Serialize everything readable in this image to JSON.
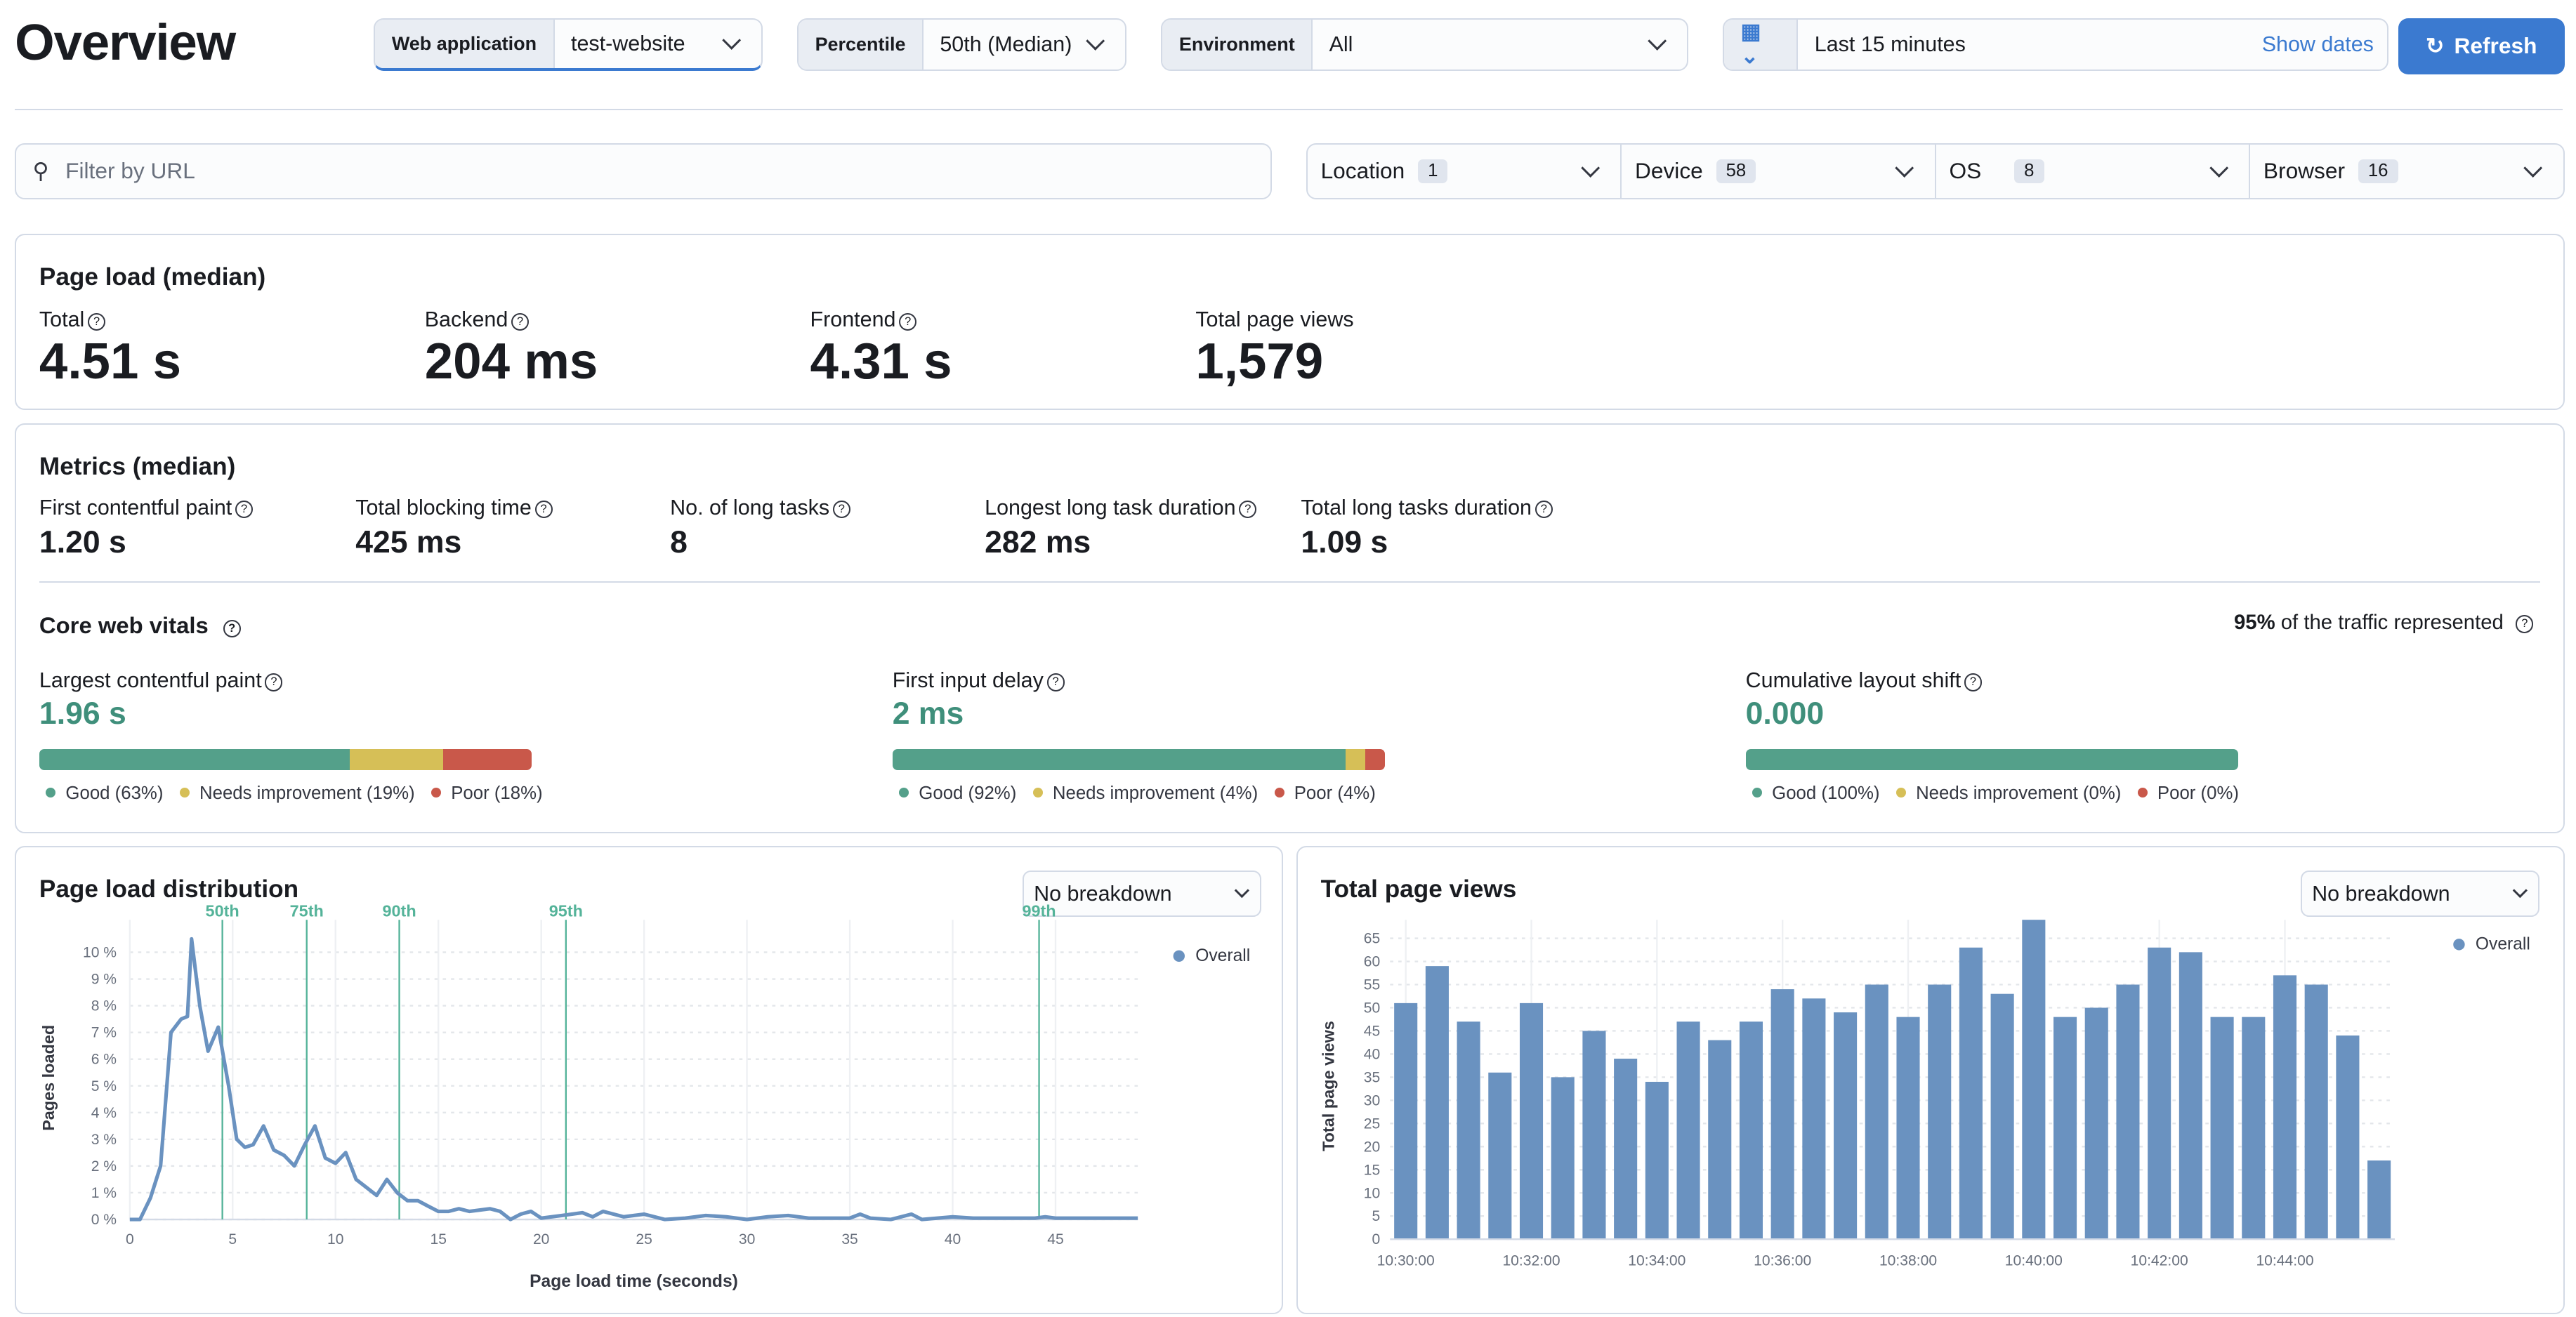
{
  "header": {
    "title": "Overview",
    "web_app": {
      "label": "Web application",
      "value": "test-website"
    },
    "percentile": {
      "label": "Percentile",
      "value": "50th (Median)"
    },
    "environment": {
      "label": "Environment",
      "value": "All"
    },
    "time": {
      "value": "Last 15 minutes",
      "show_dates": "Show dates"
    },
    "refresh": "Refresh"
  },
  "filters": {
    "search_placeholder": "Filter by URL",
    "items": [
      {
        "label": "Location",
        "count": "1"
      },
      {
        "label": "Device",
        "count": "58"
      },
      {
        "label": "OS",
        "count": "8"
      },
      {
        "label": "Browser",
        "count": "16"
      }
    ]
  },
  "page_load": {
    "title": "Page load (median)",
    "stats": [
      {
        "label": "Total",
        "value": "4.51 s"
      },
      {
        "label": "Backend",
        "value": "204 ms"
      },
      {
        "label": "Frontend",
        "value": "4.31 s"
      },
      {
        "label": "Total page views",
        "value": "1,579"
      }
    ]
  },
  "metrics": {
    "title": "Metrics (median)",
    "stats": [
      {
        "label": "First contentful paint",
        "value": "1.20 s"
      },
      {
        "label": "Total blocking time",
        "value": "425 ms"
      },
      {
        "label": "No. of long tasks",
        "value": "8"
      },
      {
        "label": "Longest long task duration",
        "value": "282 ms"
      },
      {
        "label": "Total long tasks duration",
        "value": "1.09 s"
      }
    ],
    "cwv_title": "Core web vitals",
    "traffic_pct": "95%",
    "traffic_text": "of the traffic represented",
    "vitals": [
      {
        "label": "Largest contentful paint",
        "value": "1.96 s",
        "good": 63,
        "ni": 19,
        "poor": 18,
        "legend": [
          "Good (63%)",
          "Needs improvement (19%)",
          "Poor (18%)"
        ]
      },
      {
        "label": "First input delay",
        "value": "2 ms",
        "good": 92,
        "ni": 4,
        "poor": 4,
        "legend": [
          "Good (92%)",
          "Needs improvement (4%)",
          "Poor (4%)"
        ]
      },
      {
        "label": "Cumulative layout shift",
        "value": "0.000",
        "good": 100,
        "ni": 0,
        "poor": 0,
        "legend": [
          "Good (100%)",
          "Needs improvement (0%)",
          "Poor (0%)"
        ]
      }
    ],
    "colors": {
      "good": "#54a08a",
      "ni": "#d6bf57",
      "poor": "#c9584a"
    }
  },
  "chart_data": [
    {
      "type": "line",
      "title": "Page load distribution",
      "breakdown": "No breakdown",
      "xlabel": "Page load time (seconds)",
      "ylabel": "Pages loaded",
      "xlim": [
        0,
        49
      ],
      "ylim": [
        0,
        10.6
      ],
      "xticks": [
        0,
        5,
        10,
        15,
        20,
        25,
        30,
        35,
        40,
        45
      ],
      "yticks": [
        "0 %",
        "1 %",
        "2 %",
        "3 %",
        "4 %",
        "5 %",
        "6 %",
        "7 %",
        "8 %",
        "9 %",
        "10 %"
      ],
      "series": [
        {
          "name": "Overall",
          "color": "#6a92c0",
          "x": [
            0,
            0.5,
            1,
            1.5,
            2,
            2.5,
            2.8,
            3,
            3.4,
            3.8,
            4.3,
            4.8,
            5.2,
            5.6,
            6,
            6.5,
            7,
            7.5,
            8,
            8.5,
            9,
            9.5,
            10,
            10.5,
            11,
            11.5,
            12,
            12.5,
            13,
            13.5,
            14,
            14.5,
            15,
            15.5,
            16,
            16.5,
            17.5,
            18,
            18.5,
            19,
            19.5,
            20,
            21,
            22,
            22.5,
            23,
            24,
            25,
            26,
            27,
            28,
            29,
            30,
            31,
            32,
            33,
            35,
            35.5,
            36,
            37,
            38,
            38.5,
            40,
            41,
            42,
            44,
            44.5,
            45,
            49
          ],
          "y": [
            0,
            0,
            0.8,
            2,
            7,
            7.5,
            7.6,
            10.5,
            8,
            6.3,
            7.2,
            5,
            3,
            2.7,
            2.8,
            3.5,
            2.6,
            2.4,
            2,
            2.8,
            3.5,
            2.3,
            2.1,
            2.5,
            1.5,
            1.2,
            0.9,
            1.5,
            1,
            0.7,
            0.7,
            0.5,
            0.3,
            0.3,
            0.4,
            0.3,
            0.4,
            0.3,
            0,
            0.2,
            0.3,
            0.05,
            0.15,
            0.25,
            0.1,
            0.3,
            0.1,
            0.2,
            0,
            0.05,
            0.15,
            0.1,
            0,
            0.1,
            0.15,
            0.05,
            0.05,
            0.2,
            0.05,
            0,
            0.2,
            0,
            0.1,
            0.05,
            0.05,
            0.05,
            0.1,
            0.05,
            0.05
          ]
        }
      ],
      "percentiles": [
        {
          "label": "50th",
          "x": 4.5
        },
        {
          "label": "75th",
          "x": 8.6
        },
        {
          "label": "90th",
          "x": 13.1
        },
        {
          "label": "95th",
          "x": 21.2
        },
        {
          "label": "99th",
          "x": 44.2
        }
      ],
      "legend": "top-right",
      "grid": true
    },
    {
      "type": "bar",
      "title": "Total page views",
      "breakdown": "No breakdown",
      "ylabel": "Total page views",
      "ylim": [
        0,
        69
      ],
      "yticks": [
        0,
        5,
        10,
        15,
        20,
        25,
        30,
        35,
        40,
        45,
        50,
        55,
        60,
        65
      ],
      "xticks": [
        "10:30:00",
        "10:32:00",
        "10:34:00",
        "10:36:00",
        "10:38:00",
        "10:40:00",
        "10:42:00",
        "10:44:00"
      ],
      "series": [
        {
          "name": "Overall",
          "color": "#6a92c0",
          "values": [
            51,
            59,
            47,
            36,
            51,
            35,
            45,
            39,
            34,
            47,
            43,
            47,
            54,
            52,
            49,
            55,
            48,
            55,
            63,
            53,
            69,
            48,
            50,
            55,
            63,
            62,
            48,
            48,
            57,
            55,
            44,
            17
          ]
        }
      ],
      "legend": "top-right",
      "grid": true
    }
  ]
}
